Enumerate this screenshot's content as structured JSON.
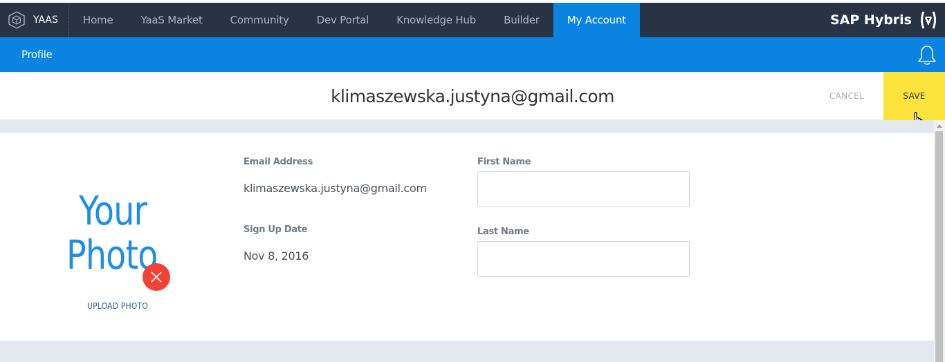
{
  "topnav": {
    "brand_label": "YAAS",
    "items": [
      {
        "label": "Home"
      },
      {
        "label": "YaaS Market"
      },
      {
        "label": "Community"
      },
      {
        "label": "Dev Portal"
      },
      {
        "label": "Knowledge Hub"
      },
      {
        "label": "Builder"
      },
      {
        "label": "My Account",
        "active": true
      }
    ],
    "company_logo_text": "SAP Hybris"
  },
  "subbar": {
    "title": "Profile"
  },
  "header": {
    "email": "klimaszewska.justyna@gmail.com",
    "cancel_label": "CANCEL",
    "save_label": "SAVE"
  },
  "profile": {
    "photo_placeholder_line1": "Your",
    "photo_placeholder_line2": "Photo",
    "upload_photo_label": "UPLOAD PHOTO",
    "email_label": "Email Address",
    "email_value": "klimaszewska.justyna@gmail.com",
    "signup_label": "Sign Up Date",
    "signup_value": "Nov 8, 2016",
    "first_name_label": "First Name",
    "first_name_value": "",
    "last_name_label": "Last Name",
    "last_name_value": ""
  },
  "colors": {
    "nav_bg": "#283445",
    "accent_blue": "#0a84e0",
    "save_yellow": "#fbe33b",
    "remove_red": "#f24137",
    "page_gray": "#e3e8ef"
  },
  "icons": [
    "yaas-cube-icon",
    "sap-hybris-bracket-icon",
    "bell-icon",
    "close-icon",
    "hand-pointer-cursor-icon"
  ]
}
